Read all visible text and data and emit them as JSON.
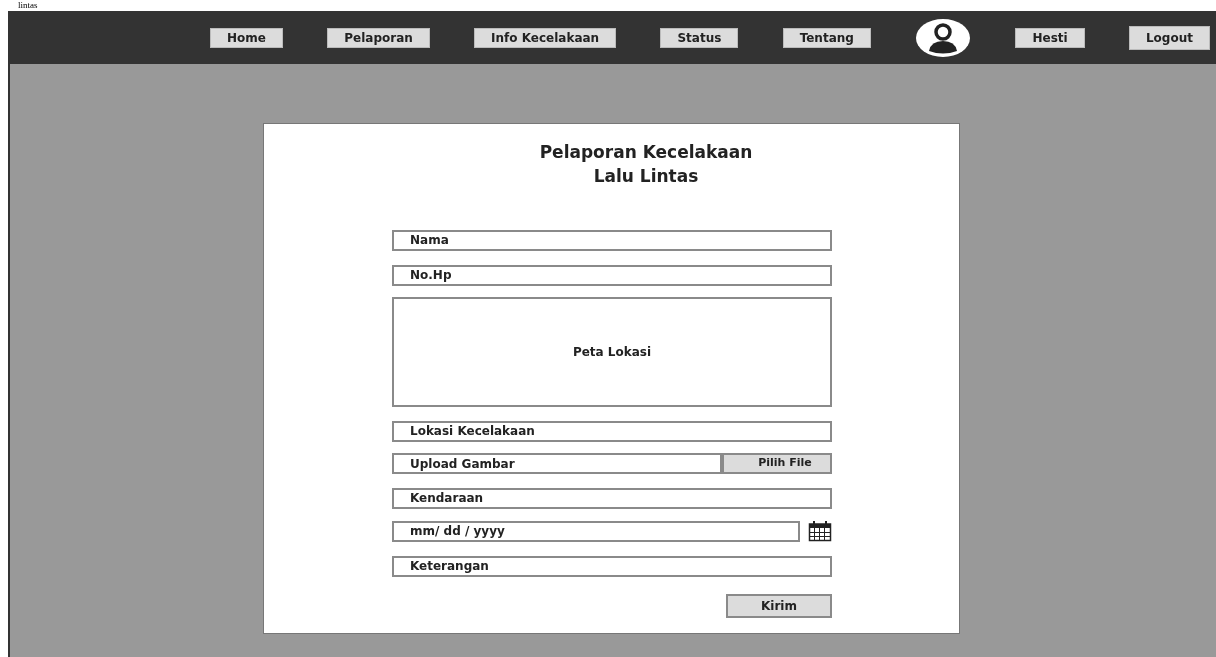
{
  "caption": "lintas",
  "nav": {
    "links": [
      {
        "label": "Home"
      },
      {
        "label": "Pelaporan"
      },
      {
        "label": "Info Kecelakaan"
      },
      {
        "label": "Status"
      },
      {
        "label": "Tentang"
      }
    ],
    "user": {
      "name": "Hesti"
    },
    "logout": "Logout"
  },
  "form": {
    "title_lines": [
      "Pelaporan Kecelakaan",
      "Lalu Lintas"
    ],
    "fields": [
      {
        "kind": "text",
        "placeholder": "Nama"
      },
      {
        "kind": "text",
        "placeholder": "No.Hp"
      },
      {
        "kind": "map",
        "label": "Peta Lokasi"
      },
      {
        "kind": "text",
        "placeholder": "Lokasi Kecelakaan"
      },
      {
        "kind": "file",
        "placeholder": "Upload Gambar",
        "button": "Pilih File"
      },
      {
        "kind": "text",
        "placeholder": "Kendaraan"
      },
      {
        "kind": "date",
        "placeholder": "mm/ dd / yyyy"
      },
      {
        "kind": "text",
        "placeholder": "Keterangan"
      }
    ],
    "submit": "Kirim"
  }
}
